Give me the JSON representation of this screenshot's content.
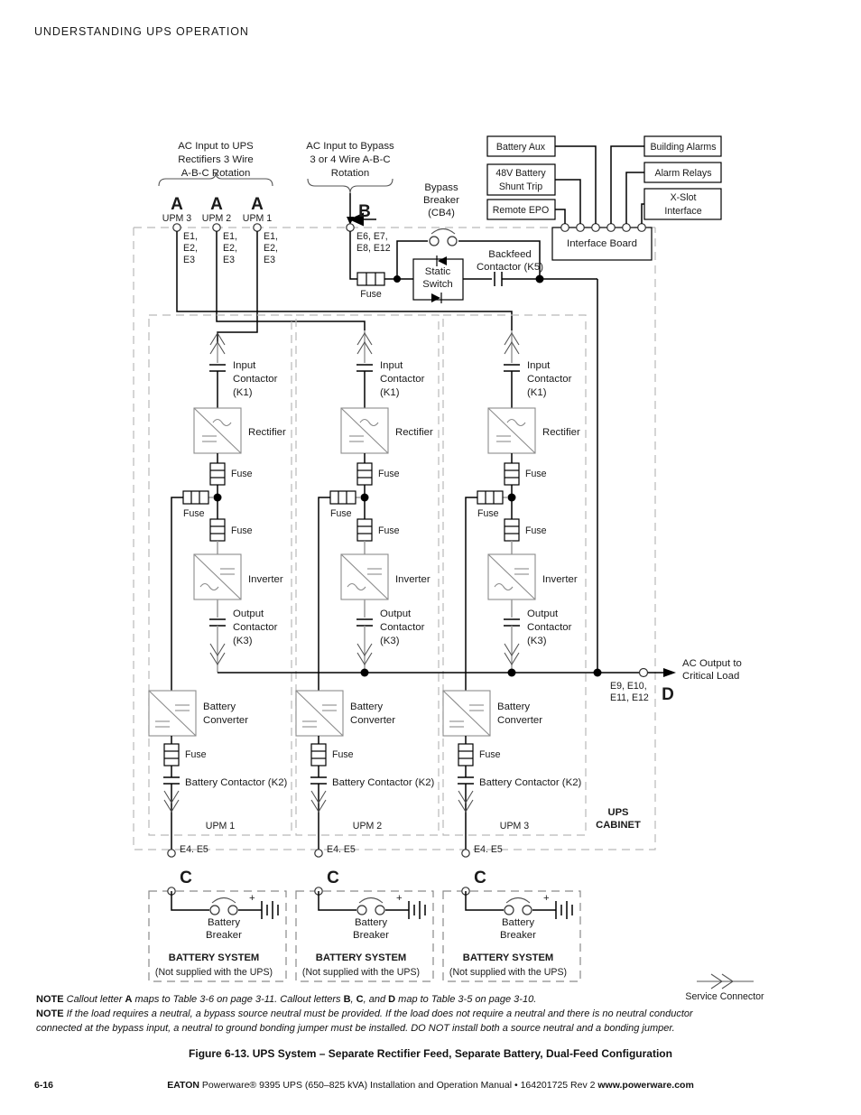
{
  "page": {
    "running_head": "UNDERSTANDING UPS OPERATION",
    "page_number": "6-16",
    "footer_bold_1": "EATON",
    "footer_plain": " Powerware® 9395 UPS (650–825 kVA) Installation and Operation Manual  •  164201725 Rev 2 ",
    "footer_bold_2": "www.powerware.com",
    "figure_caption": "Figure 6-13. UPS System – Separate Rectifier Feed, Separate Battery, Dual-Feed Configuration"
  },
  "notes": {
    "label": "NOTE",
    "note1_a": "Callout letter ",
    "note1_A": "A",
    "note1_b": " maps to Table 3-6 on page 3-11. Callout letters ",
    "note1_B": "B",
    "note1_c": ", ",
    "note1_C": "C",
    "note1_d": ", and ",
    "note1_D": "D",
    "note1_e": " map to Table 3-5 on page 3-10.",
    "note2": "If the load requires a neutral, a bypass source neutral must be provided. If the load does not require a neutral and there is no neutral conductor connected at the bypass input, a neutral to ground bonding jumper must be installed. DO NOT install both a source neutral and a bonding jumper."
  },
  "inputs": {
    "rectifier_feed": {
      "line1": "AC Input to UPS",
      "line2": "Rectifiers 3 Wire",
      "line3": "A-B-C Rotation",
      "callout": "A",
      "terminals": [
        "E1,",
        "E2,",
        "E3"
      ],
      "upm_labels": [
        "UPM  3",
        "UPM  2",
        "UPM  1"
      ]
    },
    "bypass_feed": {
      "line1": "AC Input to Bypass",
      "line2": "3 or 4 Wire A-B-C",
      "line3": "Rotation",
      "callout": "B",
      "terminals_l1": "E6, E7,",
      "terminals_l2": "E8, E12"
    }
  },
  "bypass": {
    "breaker_l1": "Bypass",
    "breaker_l2": "Breaker",
    "breaker_l3": "(CB4)",
    "fuse": "Fuse",
    "static_switch_l1": "Static",
    "static_switch_l2": "Switch",
    "backfeed_l1": "Backfeed",
    "backfeed_l2": "Contactor (K5)"
  },
  "interface": {
    "board": "Interface Board",
    "left_boxes": [
      {
        "l1": "Battery Aux",
        "l2": ""
      },
      {
        "l1": "48V Battery",
        "l2": "Shunt Trip"
      },
      {
        "l1": "Remote EPO",
        "l2": ""
      }
    ],
    "right_boxes": [
      {
        "l1": "Building Alarms",
        "l2": ""
      },
      {
        "l1": "Alarm Relays",
        "l2": ""
      },
      {
        "l1": "X-Slot",
        "l2": "Interface"
      }
    ],
    "pin_count": 6
  },
  "upm": {
    "input_contactor_l1": "Input",
    "input_contactor_l2": "Contactor",
    "input_contactor_l3": "(K1)",
    "rectifier": "Rectifier",
    "fuse": "Fuse",
    "inverter": "Inverter",
    "output_contactor_l1": "Output",
    "output_contactor_l2": "Contactor",
    "output_contactor_l3": "(K3)",
    "battery_converter_l1": "Battery",
    "battery_converter_l2": "Converter",
    "battery_contactor": "Battery Contactor (K2)",
    "names": [
      "UPM 1",
      "UPM 2",
      "UPM 3"
    ],
    "battery_terminals": "E4. E5"
  },
  "cabinet": {
    "l1": "UPS",
    "l2": "CABINET"
  },
  "output": {
    "l1": "AC Output to",
    "l2": "Critical Load",
    "terminals_l1": "E9, E10,",
    "terminals_l2": "E11, E12",
    "callout": "D"
  },
  "battery_system": {
    "callout": "C",
    "breaker_l1": "Battery",
    "breaker_l2": "Breaker",
    "title": "BATTERY SYSTEM",
    "subtitle": "(Not supplied with the UPS)"
  },
  "legend": {
    "service_connector": "Service  Connector"
  },
  "colors": {
    "ink": "#1a1a1a",
    "wire": "#000000",
    "grey_wire": "#9a9a9a",
    "dashed": "#b9b9b9"
  }
}
